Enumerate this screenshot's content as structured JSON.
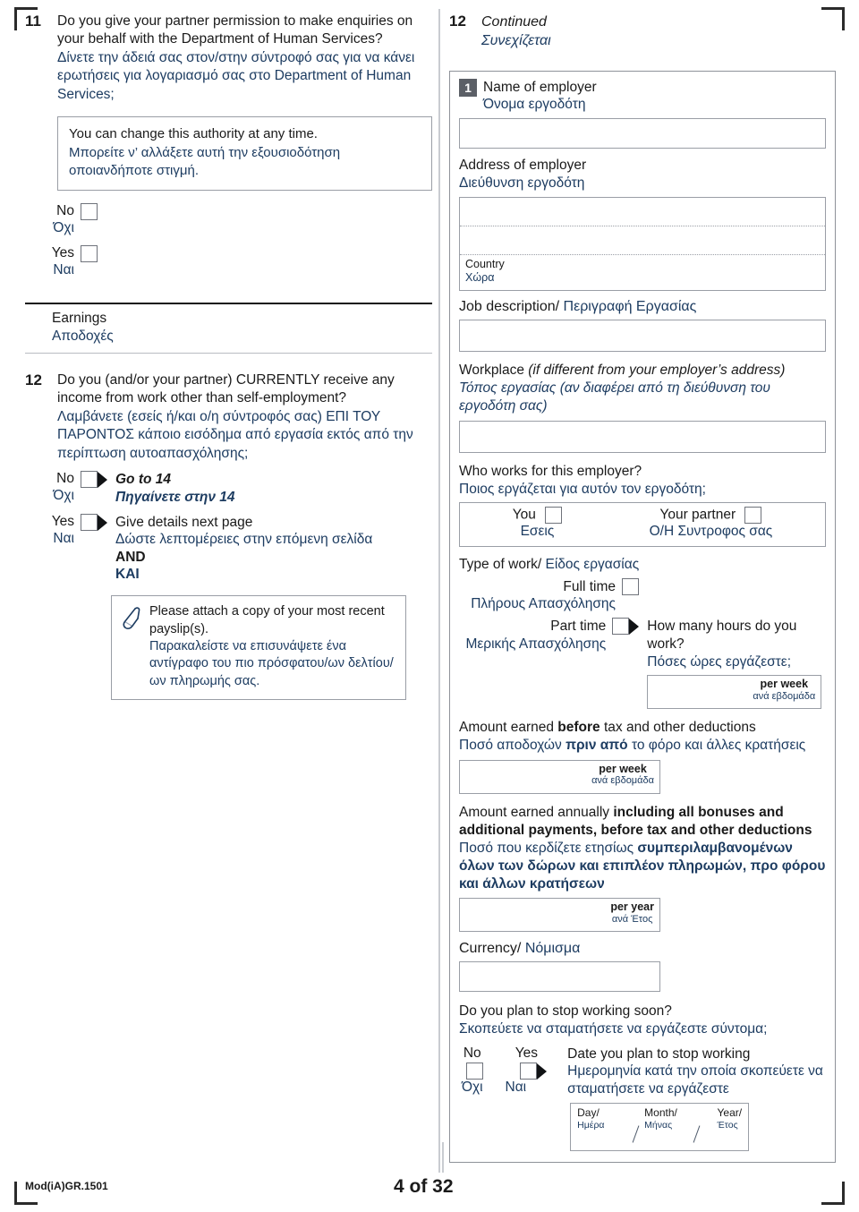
{
  "document": {
    "form_code": "Mod(iA)GR.1501",
    "page_label": "4 of 32",
    "accent_greek_color": "#1d3c61",
    "accent_english_color": "#1a1a1a",
    "badge_color": "#5b5f66"
  },
  "left_column": {
    "q11": {
      "number": "11",
      "english": "Do you give your partner permission to make enquiries on your behalf with the Department of Human Services?",
      "greek": "Δίνετε την άδειά σας στον/στην σύντροφό σας για να κάνει ερωτήσεις για λογαριασμό σας στο Department of Human Services;",
      "note": {
        "english": "You can change this authority at any time.",
        "greek": "Μπορείτε ν’ αλλάξετε αυτή την εξουσιοδότηση οποιανδήποτε στιγμή."
      },
      "options": [
        {
          "english": "No",
          "greek": "Όχι"
        },
        {
          "english": "Yes",
          "greek": "Ναι"
        }
      ]
    },
    "earnings_section": {
      "english": "Earnings",
      "greek": "Αποδοχές"
    },
    "q12": {
      "number": "12",
      "english": "Do you (and/or your partner) CURRENTLY receive any income from work other than self-employment?",
      "greek": "Λαμβάνετε (εσείς ή/και ο/η σύντροφός σας) ΕΠΙ ΤΟΥ ΠΑΡΟΝΤΟΣ κάποιο εισόδημα από εργασία εκτός από την περίπτωση αυτοαπασχόλησης;",
      "option_no": {
        "english": "No",
        "greek": "Όχι",
        "action_english": "Go to 14",
        "action_greek": "Πηγαίνετε στην 14"
      },
      "option_yes": {
        "english": "Yes",
        "greek": "Ναι",
        "action_english": "Give details next page",
        "action_greek": "Δώστε λεπτομέρειες στην επόμενη σελίδα",
        "and_english": "AND",
        "and_greek": "ΚΑΙ"
      },
      "attach_note": {
        "icon": "paperclip-icon",
        "english": "Please attach a copy of your most recent payslip(s).",
        "greek": "Παρακαλείστε να επισυνάψετε ένα αντίγραφο του πιο πρόσφατου/ων δελτίου/ων πληρωμής σας."
      }
    }
  },
  "right_column": {
    "header": {
      "number": "12",
      "english": "Continued",
      "greek": "Συνεχίζεται"
    },
    "employer": {
      "badge": "1",
      "name": {
        "english": "Name of employer",
        "greek": "Όνομα εργοδότη",
        "value": ""
      },
      "address": {
        "english": "Address of employer",
        "greek": "Διεύθυνση εργοδότη",
        "line1_value": "",
        "line2_value": "",
        "country_english": "Country",
        "country_greek": "Χώρα",
        "country_value": ""
      },
      "job_description": {
        "english": "Job description/",
        "greek": "Περιγραφή Εργασίας",
        "value": ""
      },
      "workplace": {
        "english_bold": "Workplace",
        "english_italic": "(if different from your employer’s address)",
        "greek": "Τόπος εργασίας (αν διαφέρει από τη διεύθυνση του εργοδότη σας)",
        "value": ""
      },
      "who_works": {
        "english": "Who works for this employer?",
        "greek": "Ποιος εργάζεται για αυτόν τον εργοδότη;",
        "options": [
          {
            "english": "You",
            "greek": "Εσεις"
          },
          {
            "english": "Your partner",
            "greek": "Ο/Η Συντροφος σας"
          }
        ]
      },
      "type_of_work": {
        "english": "Type of work/",
        "greek": "Είδος εργασίας",
        "full_time": {
          "english": "Full time",
          "greek": "Πλήρους Απασχόλησης"
        },
        "part_time": {
          "english": "Part time",
          "greek": "Μερικής Απασχόλησης"
        },
        "hours_question_english": "How many hours do you work?",
        "hours_question_greek": "Πόσες ώρες εργάζεστε;",
        "hours_value": "",
        "hours_unit_english": "per week",
        "hours_unit_greek": "ανά εβδομάδα"
      },
      "amount_before_tax": {
        "english_pre": "Amount earned ",
        "english_bold": "before",
        "english_post": " tax and other deductions",
        "greek_pre": "Ποσό αποδοχών ",
        "greek_bold": "πριν από",
        "greek_post": " το φόρο και άλλες κρατήσεις",
        "value": "",
        "unit_english": "per week",
        "unit_greek": "ανά εβδομάδα"
      },
      "amount_annual": {
        "english_pre": "Amount earned annually ",
        "english_bold": "including all bonuses and additional payments, before tax and other deductions",
        "greek_pre": "Ποσό που κερδίζετε ετησίως ",
        "greek_bold": "συμπεριλαμβανομένων όλων των δώρων και επιπλέον πληρωμών, προ φόρου και άλλων κρατήσεων",
        "value": "",
        "unit_english": "per year",
        "unit_greek": "ανά Έτος"
      },
      "currency": {
        "english": "Currency/",
        "greek": "Νόμισμα",
        "value": ""
      },
      "stop_working": {
        "english": "Do you plan to stop working soon?",
        "greek": "Σκοπεύετε να σταματήσετε να εργάζεστε σύντομα;",
        "option_no": {
          "english": "No",
          "greek": "Όχι"
        },
        "option_yes": {
          "english": "Yes",
          "greek": "Ναι"
        },
        "date_label_english": "Date you plan to stop working",
        "date_label_greek": "Ημερομηνία κατά την οποία σκοπεύετε να σταματήσετε να εργάζεστε",
        "date_headers": [
          {
            "english": "Day/",
            "greek": "Ημέρα"
          },
          {
            "english": "Month/",
            "greek": "Μήνας"
          },
          {
            "english": "Year/",
            "greek": "Έτος"
          }
        ],
        "date_value": ""
      }
    }
  }
}
